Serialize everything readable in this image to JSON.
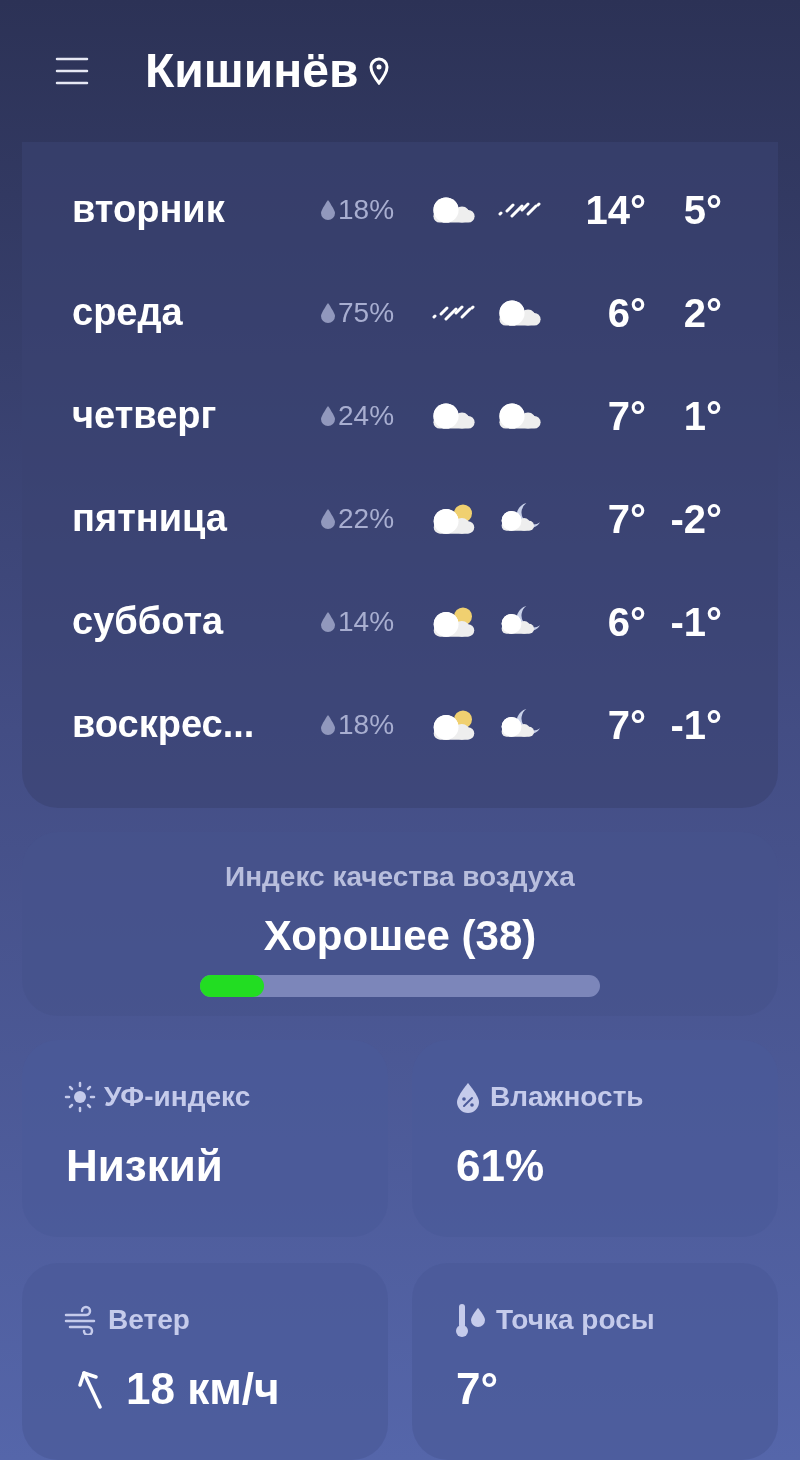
{
  "header": {
    "city": "Кишинёв"
  },
  "forecast": [
    {
      "day": "вторник",
      "precip": "18%",
      "icons": [
        {
          "kind": "cloudy"
        },
        {
          "kind": "rain"
        }
      ],
      "high": "14°",
      "low": "5°"
    },
    {
      "day": "среда",
      "precip": "75%",
      "icons": [
        {
          "kind": "rain"
        },
        {
          "kind": "cloudy"
        }
      ],
      "high": "6°",
      "low": "2°"
    },
    {
      "day": "четверг",
      "precip": "24%",
      "icons": [
        {
          "kind": "cloudy"
        },
        {
          "kind": "cloudy"
        }
      ],
      "high": "7°",
      "low": "1°"
    },
    {
      "day": "пятница",
      "precip": "22%",
      "icons": [
        {
          "kind": "sun"
        },
        {
          "kind": "moon"
        }
      ],
      "high": "7°",
      "low": "-2°"
    },
    {
      "day": "суббота",
      "precip": "14%",
      "icons": [
        {
          "kind": "sun"
        },
        {
          "kind": "moon"
        }
      ],
      "high": "6°",
      "low": "-1°"
    },
    {
      "day": "воскрес...",
      "precip": "18%",
      "icons": [
        {
          "kind": "sun"
        },
        {
          "kind": "moon"
        }
      ],
      "high": "7°",
      "low": "-1°"
    }
  ],
  "air_quality": {
    "title": "Индекс качества воздуха",
    "value": "Хорошее (38)",
    "level": 0.16,
    "color": "#22dd22"
  },
  "tiles": [
    {
      "kind": "uv",
      "title": "УФ-индекс",
      "value": "Низкий"
    },
    {
      "kind": "humidity",
      "title": "Влажность",
      "value": "61%"
    },
    {
      "kind": "wind",
      "title": "Ветер",
      "value": "18 км/ч"
    },
    {
      "kind": "dew",
      "title": "Точка росы",
      "value": "7°"
    }
  ]
}
